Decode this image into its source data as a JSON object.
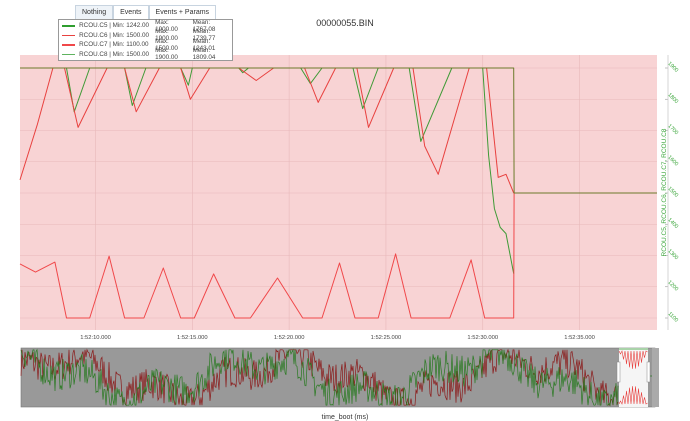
{
  "buttons": [
    {
      "label": "Nothing",
      "active": true
    },
    {
      "label": "Events",
      "active": false
    },
    {
      "label": "Events + Params",
      "active": false
    }
  ],
  "legend": [
    {
      "name": "RCOU.C5 | Min: 1242.00",
      "max": "Max: 1900.00",
      "mean": "Mean: 1767.08",
      "color": "#2f9e2f"
    },
    {
      "name": "RCOU.C6 | Min: 1500.00",
      "max": "Max: 1900.00",
      "mean": "Mean: 1739.77",
      "color": "#e8413f"
    },
    {
      "name": "RCOU.C7 | Min: 1100.00",
      "max": "Max: 1500.00",
      "mean": "Mean: 1243.01",
      "color": "#f0484a"
    },
    {
      "name": "RCOU.C8 | Min: 1500.00",
      "max": "Max: 1900.00",
      "mean": "Mean: 1809.04",
      "color": "#5fb35f"
    }
  ],
  "chart_data": {
    "type": "line",
    "title": "00000055.BIN",
    "xlabel": "time_boot (ms)",
    "ylabel": "RCOU.C5, RCOU.C6, RCOU.C7, RCOU.C8",
    "xlim": [
      "1:52:06.1",
      "1:52:39.0"
    ],
    "ylim": [
      1100,
      1900
    ],
    "x_ticks": [
      "1:52:10.000",
      "1:52:15.000",
      "1:52:20.000",
      "1:52:25.000",
      "1:52:30.000",
      "1:52:35.000"
    ],
    "y_ticks": [
      "1900",
      "1800",
      "1700",
      "1600",
      "1500",
      "1400",
      "1300",
      "1200",
      "1100"
    ],
    "grid": true,
    "background": "#f8d3d4",
    "series": [
      {
        "name": "RCOU.C5",
        "color": "#3f9a36",
        "points": [
          [
            "1:52:06.1",
            1900
          ],
          [
            "1:52:08.5",
            1900
          ],
          [
            "1:52:08.9",
            1760
          ],
          [
            "1:52:09.7",
            1900
          ],
          [
            "1:52:11.5",
            1900
          ],
          [
            "1:52:11.9",
            1780
          ],
          [
            "1:52:12.6",
            1900
          ],
          [
            "1:52:14.4",
            1900
          ],
          [
            "1:52:14.8",
            1845
          ],
          [
            "1:52:15.0",
            1900
          ],
          [
            "1:52:17.4",
            1900
          ],
          [
            "1:52:17.6",
            1885
          ],
          [
            "1:52:17.9",
            1900
          ],
          [
            "1:52:20.6",
            1900
          ],
          [
            "1:52:21.1",
            1850
          ],
          [
            "1:52:21.7",
            1900
          ],
          [
            "1:52:23.3",
            1900
          ],
          [
            "1:52:23.8",
            1770
          ],
          [
            "1:52:24.6",
            1900
          ],
          [
            "1:52:26.2",
            1900
          ],
          [
            "1:52:26.8",
            1665
          ],
          [
            "1:52:28.4",
            1900
          ],
          [
            "1:52:30.0",
            1900
          ],
          [
            "1:52:30.3",
            1620
          ],
          [
            "1:52:30.6",
            1450
          ],
          [
            "1:52:30.9",
            1390
          ],
          [
            "1:52:31.2",
            1370
          ],
          [
            "1:52:31.6",
            1242
          ]
        ]
      },
      {
        "name": "RCOU.C6",
        "color": "#e8413f",
        "points": [
          [
            "1:52:06.1",
            1542
          ],
          [
            "1:52:07.0",
            1720
          ],
          [
            "1:52:07.8",
            1900
          ],
          [
            "1:52:08.4",
            1900
          ],
          [
            "1:52:09.1",
            1710
          ],
          [
            "1:52:10.6",
            1900
          ],
          [
            "1:52:11.5",
            1900
          ],
          [
            "1:52:12.1",
            1760
          ],
          [
            "1:52:13.3",
            1900
          ],
          [
            "1:52:14.4",
            1900
          ],
          [
            "1:52:14.9",
            1800
          ],
          [
            "1:52:15.9",
            1900
          ],
          [
            "1:52:17.4",
            1900
          ],
          [
            "1:52:18.3",
            1860
          ],
          [
            "1:52:19.2",
            1900
          ],
          [
            "1:52:20.8",
            1900
          ],
          [
            "1:52:21.5",
            1790
          ],
          [
            "1:52:22.4",
            1900
          ],
          [
            "1:52:23.5",
            1900
          ],
          [
            "1:52:24.1",
            1710
          ],
          [
            "1:52:25.4",
            1900
          ],
          [
            "1:52:26.4",
            1900
          ],
          [
            "1:52:27.0",
            1650
          ],
          [
            "1:52:27.7",
            1560
          ],
          [
            "1:52:29.3",
            1900
          ],
          [
            "1:52:30.2",
            1900
          ],
          [
            "1:52:30.8",
            1550
          ],
          [
            "1:52:31.2",
            1560
          ],
          [
            "1:52:31.6",
            1500
          ]
        ]
      },
      {
        "name": "RCOU.C7",
        "color": "#f0484a",
        "points": [
          [
            "1:52:06.1",
            1273
          ],
          [
            "1:52:06.9",
            1247
          ],
          [
            "1:52:07.9",
            1279
          ],
          [
            "1:52:08.5",
            1100
          ],
          [
            "1:52:09.7",
            1100
          ],
          [
            "1:52:10.7",
            1298
          ],
          [
            "1:52:11.5",
            1100
          ],
          [
            "1:52:12.5",
            1100
          ],
          [
            "1:52:13.5",
            1260
          ],
          [
            "1:52:14.4",
            1100
          ],
          [
            "1:52:15.1",
            1100
          ],
          [
            "1:52:16.1",
            1241
          ],
          [
            "1:52:17.2",
            1100
          ],
          [
            "1:52:18.0",
            1100
          ],
          [
            "1:52:19.4",
            1228
          ],
          [
            "1:52:20.7",
            1100
          ],
          [
            "1:52:21.7",
            1100
          ],
          [
            "1:52:22.6",
            1276
          ],
          [
            "1:52:23.4",
            1100
          ],
          [
            "1:52:24.6",
            1100
          ],
          [
            "1:52:25.5",
            1305
          ],
          [
            "1:52:26.3",
            1100
          ],
          [
            "1:52:28.3",
            1100
          ],
          [
            "1:52:29.4",
            1286
          ],
          [
            "1:52:30.1",
            1100
          ],
          [
            "1:52:31.6",
            1100
          ],
          [
            "1:52:31.62",
            1500
          ]
        ]
      },
      {
        "name": "RCOU.C8",
        "color": "#6b7a2a",
        "points": [
          [
            "1:52:06.1",
            1900
          ],
          [
            "1:52:31.6",
            1900
          ],
          [
            "1:52:31.62",
            1500
          ],
          [
            "1:52:39.0",
            1500
          ]
        ]
      }
    ]
  }
}
